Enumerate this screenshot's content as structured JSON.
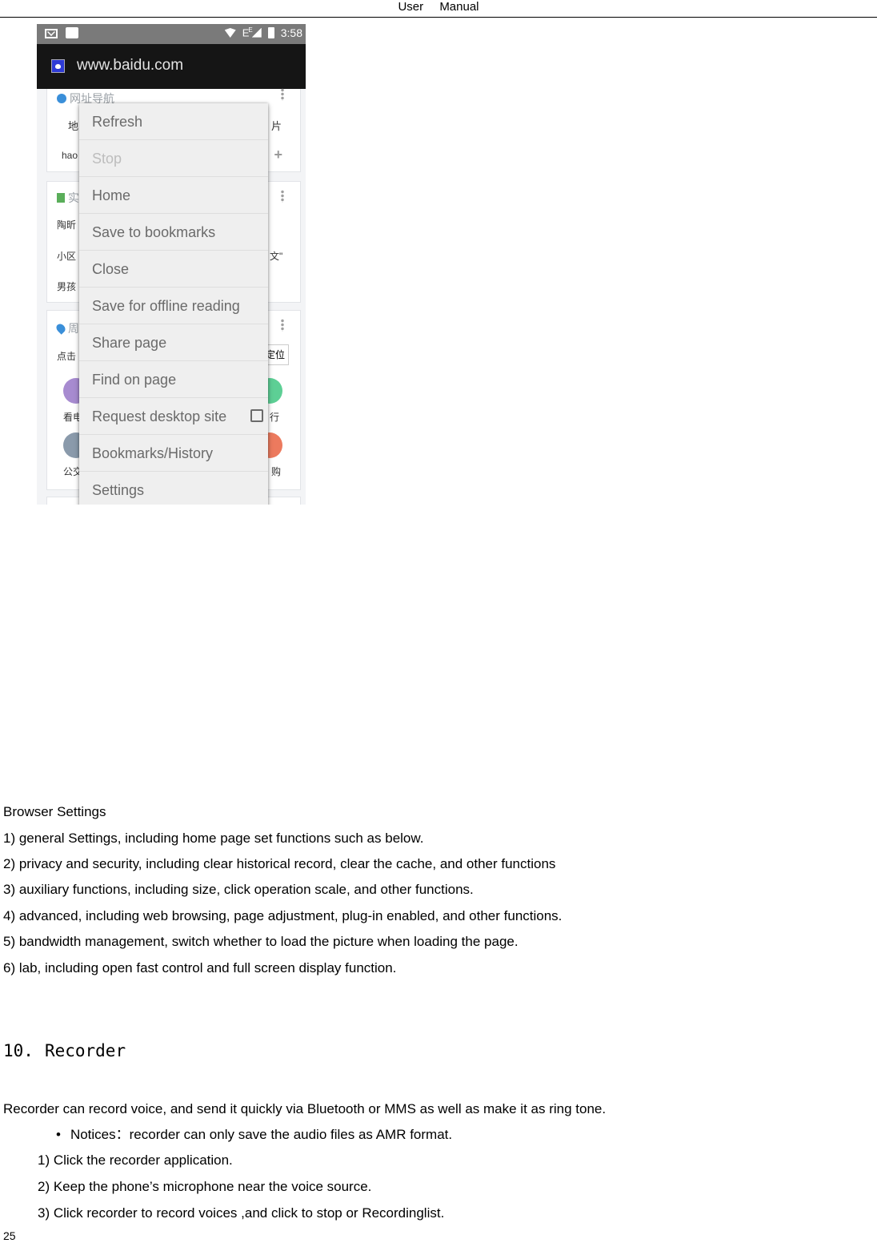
{
  "header": {
    "left": "User",
    "right": "Manual"
  },
  "phone": {
    "status_bar": {
      "time": "3:58",
      "network": "E",
      "network_sup": "E"
    },
    "url_bar": {
      "url": "www.baidu.com"
    },
    "cards": [
      {
        "title": "网址导航",
        "fragments": [
          "地",
          "hao",
          "片"
        ]
      },
      {
        "title": "实",
        "fragments": [
          "陶昕",
          "小区",
          "男孩",
          "文\""
        ]
      },
      {
        "title": "周",
        "fragments": [
          "点击",
          "看电",
          "公交",
          "行",
          "购"
        ],
        "locate_button": "定位"
      }
    ],
    "menu": {
      "items": [
        {
          "label": "Refresh",
          "enabled": true
        },
        {
          "label": "Stop",
          "enabled": false
        },
        {
          "label": "Home",
          "enabled": true
        },
        {
          "label": "Save to bookmarks",
          "enabled": true
        },
        {
          "label": "Close",
          "enabled": true
        },
        {
          "label": "Save for offline reading",
          "enabled": true
        },
        {
          "label": "Share page",
          "enabled": true
        },
        {
          "label": "Find on page",
          "enabled": true
        },
        {
          "label": "Request desktop site",
          "enabled": true,
          "checkbox": false
        },
        {
          "label": "Bookmarks/History",
          "enabled": true
        },
        {
          "label": "Settings",
          "enabled": true
        }
      ]
    }
  },
  "browser_settings": {
    "title": "Browser Settings",
    "items": [
      "1) general Settings, including home page set functions such as below.",
      "2) privacy and security, including clear historical record, clear the cache, and other functions",
      "3) auxiliary functions, including size, click operation scale, and other functions.",
      "4) advanced, including web browsing, page adjustment, plug-in enabled, and other functions.",
      "5) bandwidth management, switch whether to load the picture when loading the page.",
      "6) lab, including open fast control and full screen display function."
    ]
  },
  "recorder": {
    "number": "10.",
    "title": "Recorder",
    "intro": "Recorder can record voice, and send it quickly via Bluetooth or MMS as well as make it as ring tone.",
    "notice": "Notices：recorder can only save the audio files as AMR format.",
    "steps": [
      "1) Click the recorder application.",
      "2)  Keep the phone’s microphone near the voice source.",
      "3) Click recorder to record voices ,and click to stop or Recordinglist."
    ]
  },
  "page_number": "25"
}
